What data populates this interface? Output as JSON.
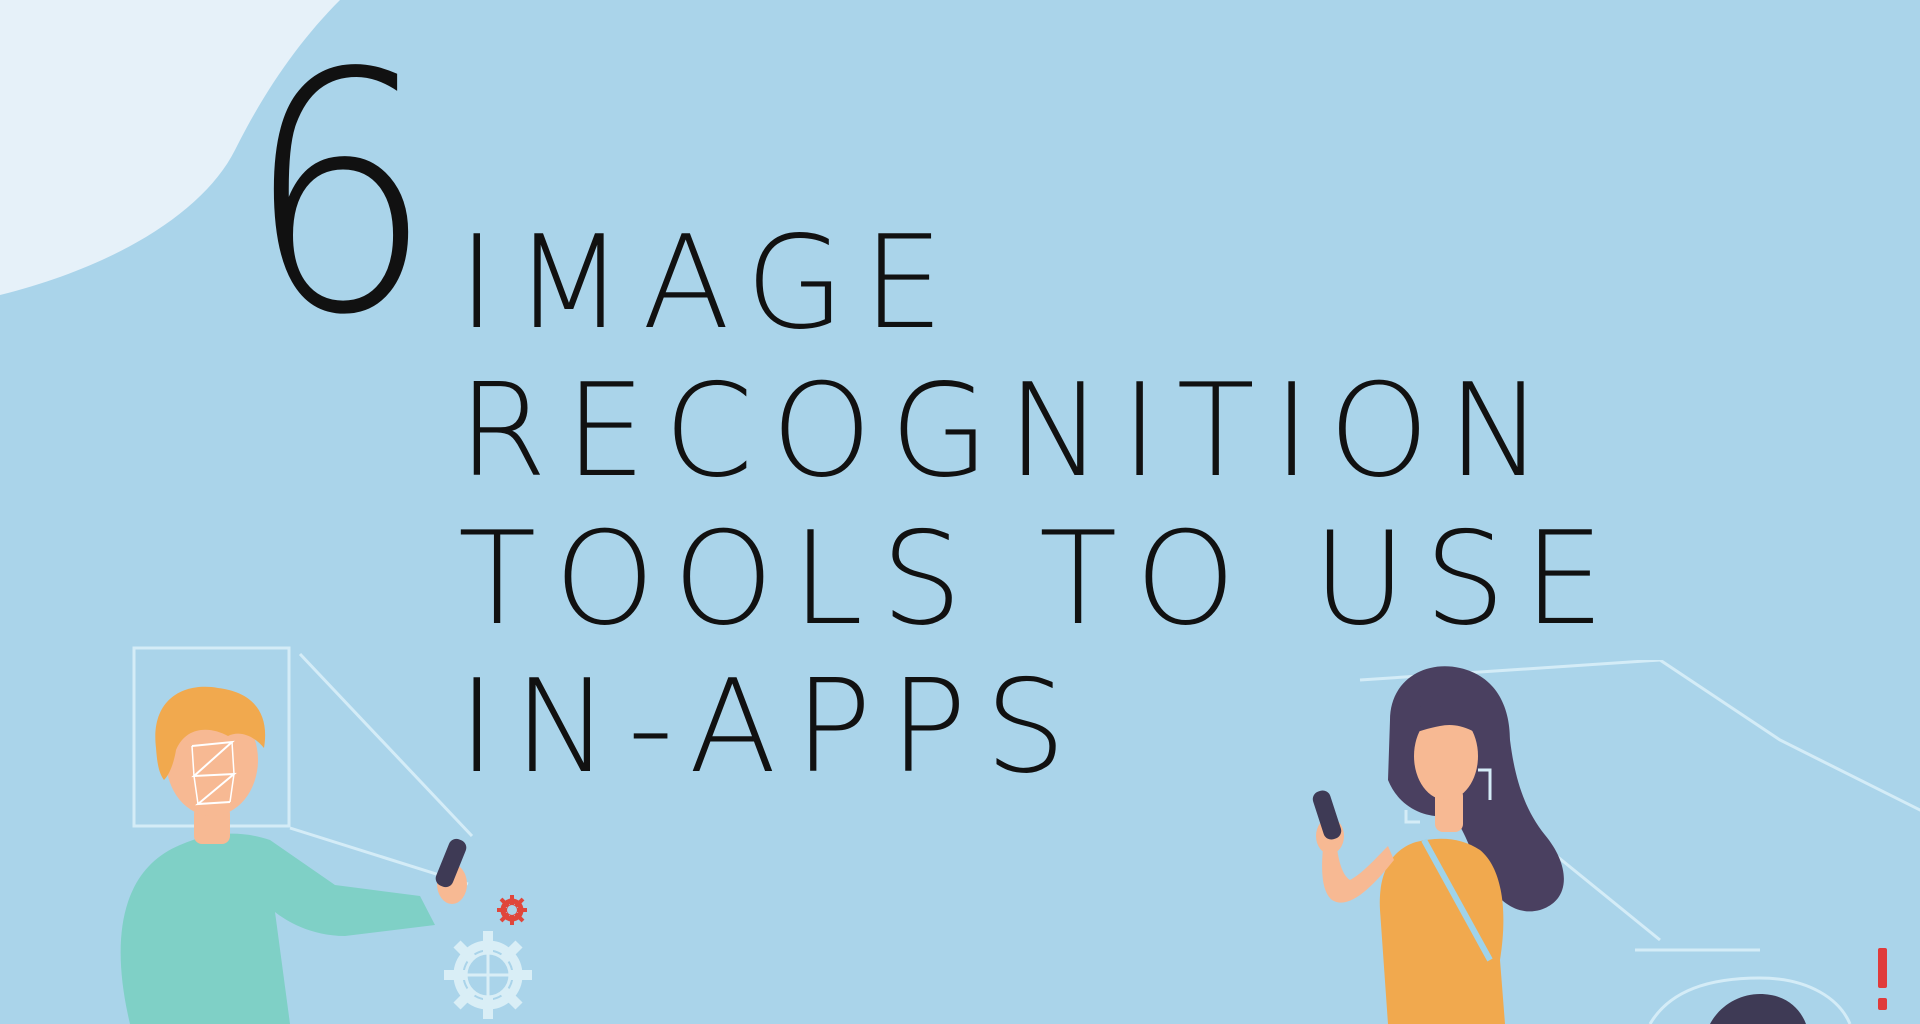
{
  "headline": {
    "number": "6",
    "lines": [
      "IMAGE",
      "RECOGNITION",
      "TOOLS TO USE",
      "IN-APPS"
    ]
  },
  "colors": {
    "background": "#aad4ea",
    "blob": "#e6f1f9",
    "text": "#111111",
    "man_shirt": "#7fd0c6",
    "man_hair": "#f1a94e",
    "skin": "#f7b993",
    "woman_hair": "#4a4060",
    "woman_top": "#f1a94e",
    "frame_lines": "#d4ecf7",
    "alert": "#e03b3b",
    "gear_red": "#e0463b",
    "gear_light": "#d9eef6"
  },
  "icons": [
    "face-scan-frame-icon",
    "gear-icon",
    "small-gear-icon",
    "phone-icon",
    "alert-icon"
  ]
}
